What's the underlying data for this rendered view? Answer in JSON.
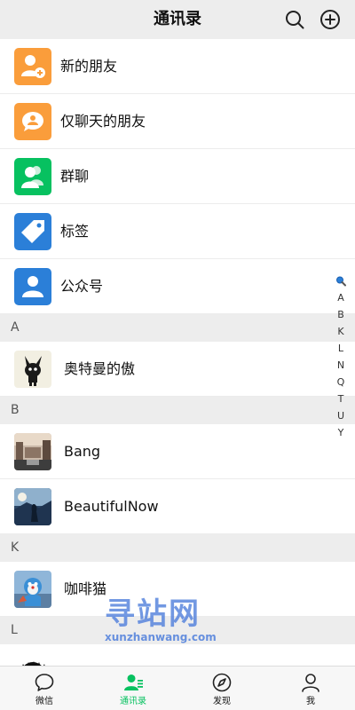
{
  "header": {
    "title": "通讯录"
  },
  "function_items": [
    {
      "label": "新的朋友",
      "icon": "new-friend-icon",
      "color": "#fa9d3b"
    },
    {
      "label": "仅聊天的朋友",
      "icon": "chat-only-friend-icon",
      "color": "#fa9d3b"
    },
    {
      "label": "群聊",
      "icon": "group-chat-icon",
      "color": "#07c160"
    },
    {
      "label": "标签",
      "icon": "tag-icon",
      "color": "#2b7fd8"
    },
    {
      "label": "公众号",
      "icon": "official-account-icon",
      "color": "#2b7fd8"
    }
  ],
  "sections": [
    {
      "letter": "A",
      "contacts": [
        {
          "name": "奥特曼的傲"
        }
      ]
    },
    {
      "letter": "B",
      "contacts": [
        {
          "name": "Bang"
        },
        {
          "name": "BeautifulNow"
        }
      ]
    },
    {
      "letter": "K",
      "contacts": [
        {
          "name": "咖啡猫"
        }
      ]
    },
    {
      "letter": "L",
      "contacts": []
    }
  ],
  "index_bar": {
    "search_icon": "magnifier-icon",
    "letters": [
      "A",
      "B",
      "K",
      "L",
      "N",
      "Q",
      "T",
      "U",
      "Y"
    ]
  },
  "watermark": {
    "main": "寻站网",
    "sub": "xunzhanwang.com"
  },
  "tabbar": {
    "tabs": [
      {
        "label": "微信",
        "icon": "chat-bubble-icon"
      },
      {
        "label": "通讯录",
        "icon": "contacts-icon"
      },
      {
        "label": "发现",
        "icon": "compass-icon"
      },
      {
        "label": "我",
        "icon": "person-icon"
      }
    ],
    "active_index": 1
  },
  "colors": {
    "accent": "#07c160",
    "orange": "#fa9d3b",
    "blue": "#2b7fd8",
    "background": "#ededed"
  }
}
